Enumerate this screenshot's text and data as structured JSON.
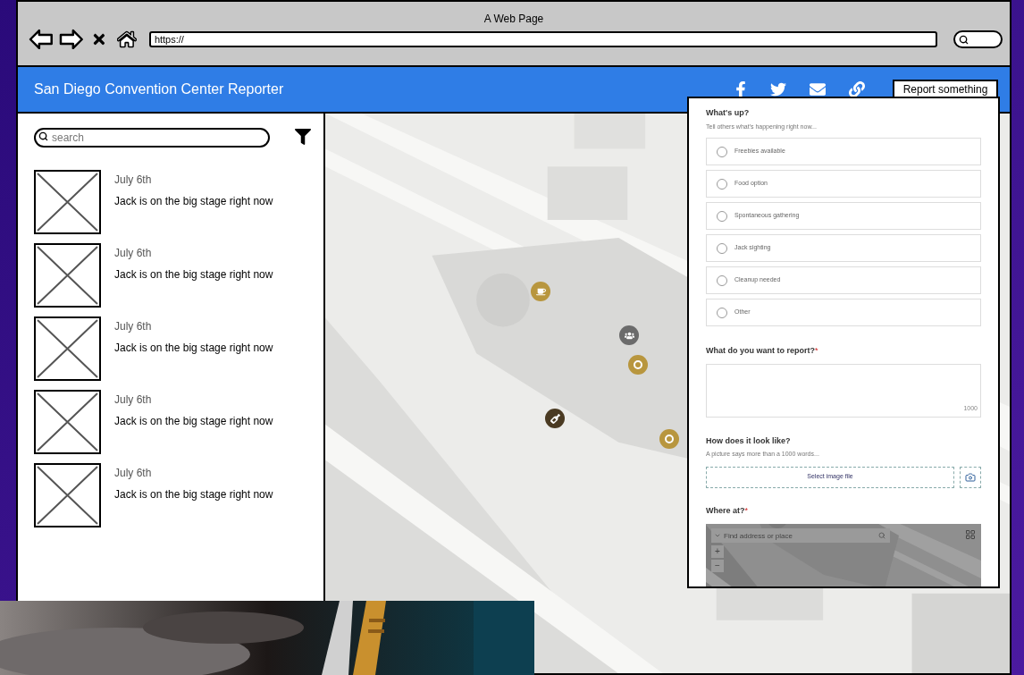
{
  "browser": {
    "title": "A Web Page",
    "url": "https://"
  },
  "header": {
    "title": "San Diego Convention Center Reporter",
    "report_button": "Report something"
  },
  "sidebar": {
    "search": {
      "placeholder": "search"
    },
    "items": [
      {
        "date": "July 6th",
        "text": "Jack is on the big stage right now"
      },
      {
        "date": "July 6th",
        "text": "Jack is on the big stage right now"
      },
      {
        "date": "July 6th",
        "text": "Jack is on the big stage right now"
      },
      {
        "date": "July 6th",
        "text": "Jack is on the big stage right now"
      },
      {
        "date": "July 6th",
        "text": "Jack is on the big stage right now"
      }
    ]
  },
  "form": {
    "whats_up": {
      "label": "What's up?",
      "hint": "Tell others what's happening right now...",
      "options": [
        {
          "label": "Freebies available",
          "selected": false
        },
        {
          "label": "Food option",
          "selected": false
        },
        {
          "label": "Spontaneous gathering",
          "selected": false
        },
        {
          "label": "Jack sighting",
          "selected": false
        },
        {
          "label": "Cleanup needed",
          "selected": false
        },
        {
          "label": "Other",
          "selected": false
        }
      ]
    },
    "report": {
      "label": "What do you want to report?",
      "required_mark": "*",
      "counter": "1000"
    },
    "photo": {
      "label": "How does it look like?",
      "hint": "A picture says more than a 1000 words...",
      "button": "Select image file"
    },
    "location": {
      "label": "Where at?",
      "required_mark": "*",
      "search": {
        "placeholder": "Find address or place"
      },
      "zoom_in": "+",
      "zoom_out": "−"
    }
  }
}
